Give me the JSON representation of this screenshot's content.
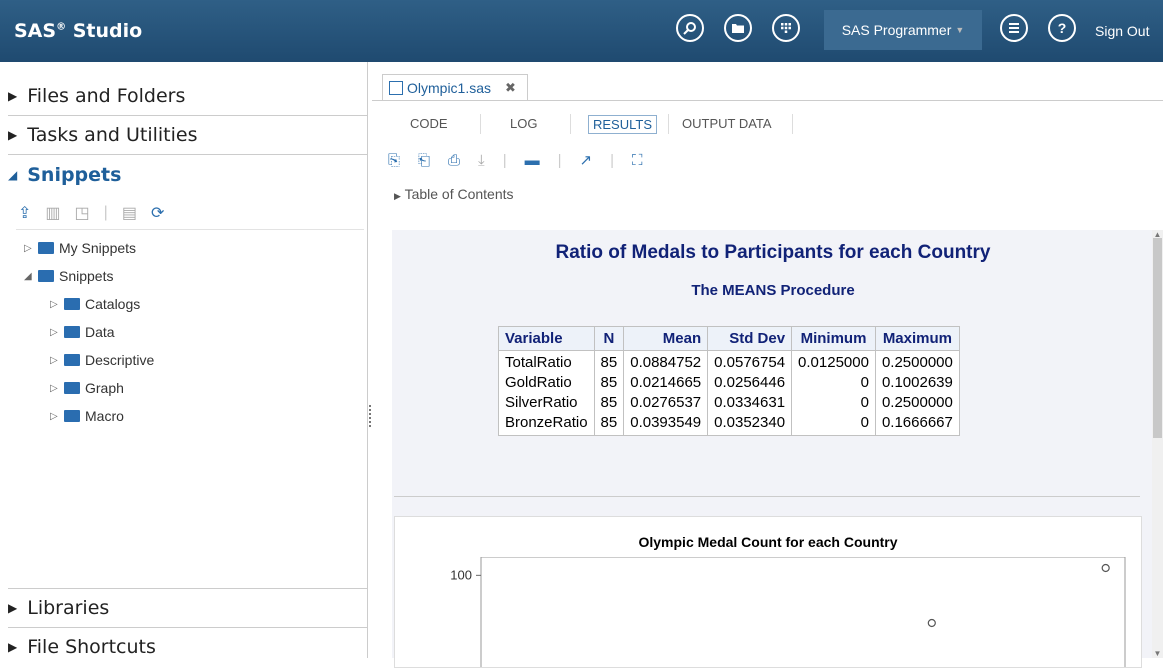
{
  "app": {
    "brand": "SAS",
    "brand_sup": "®",
    "brand_suffix": " Studio"
  },
  "header": {
    "user_label": "SAS Programmer",
    "signout_label": "Sign Out",
    "icons": [
      "search-icon",
      "folder-icon",
      "apps-icon",
      "menu-list-icon",
      "help-icon"
    ],
    "help_glyph": "?"
  },
  "sidebar": {
    "sections": {
      "files": "Files and Folders",
      "tasks": "Tasks and Utilities",
      "snippets": "Snippets",
      "libraries": "Libraries",
      "shortcuts": "File Shortcuts"
    },
    "tree": {
      "my_snippets": "My Snippets",
      "snippets": "Snippets",
      "children": [
        "Catalogs",
        "Data",
        "Descriptive",
        "Graph",
        "Macro"
      ]
    }
  },
  "editor": {
    "file_tab": "Olympic1.sas",
    "tabs": [
      "CODE",
      "LOG",
      "RESULTS",
      "OUTPUT DATA"
    ],
    "selected_tab": "RESULTS",
    "toc_label": "Table of Contents"
  },
  "results": {
    "title": "Ratio of Medals to Participants for each Country",
    "subtitle": "The MEANS Procedure",
    "table": {
      "headers": [
        "Variable",
        "N",
        "Mean",
        "Std Dev",
        "Minimum",
        "Maximum"
      ],
      "rows": [
        [
          "TotalRatio",
          "85",
          "0.0884752",
          "0.0576754",
          "0.0125000",
          "0.2500000"
        ],
        [
          "GoldRatio",
          "85",
          "0.0214665",
          "0.0256446",
          "0",
          "0.1002639"
        ],
        [
          "SilverRatio",
          "85",
          "0.0276537",
          "0.0334631",
          "0",
          "0.2500000"
        ],
        [
          "BronzeRatio",
          "85",
          "0.0393549",
          "0.0352340",
          "0",
          "0.1666667"
        ]
      ]
    },
    "graph_title": "Olympic Medal Count for each Country"
  },
  "chart_data": {
    "type": "scatter",
    "title": "Olympic Medal Count for each Country",
    "yticks": [
      100
    ],
    "points": [
      {
        "x": 0.97,
        "y": 104
      },
      {
        "x": 0.7,
        "y": 74
      }
    ],
    "marker": "open-circle",
    "color": "#555555"
  }
}
